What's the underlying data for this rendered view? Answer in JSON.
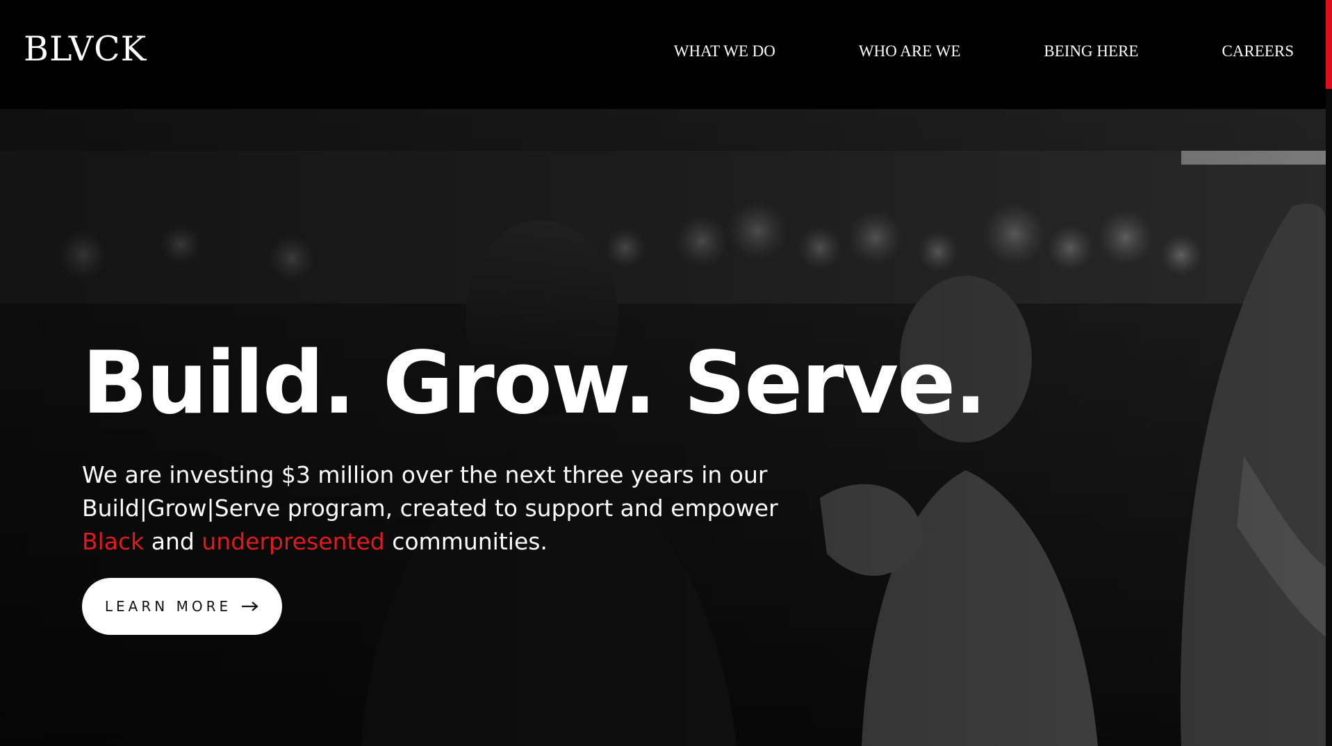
{
  "header": {
    "logo": "BLVCK",
    "nav": [
      {
        "label": "WHAT WE DO"
      },
      {
        "label": "WHO ARE WE"
      },
      {
        "label": "BEING HERE"
      },
      {
        "label": "CAREERS"
      }
    ]
  },
  "hero": {
    "title": "Build. Grow. Serve.",
    "desc_part1": "We are investing $3 million over the next three years in our Build|Grow|Serve program, created to support and empower ",
    "desc_highlight1": "Black",
    "desc_part2": " and ",
    "desc_highlight2": "underpresented",
    "desc_part3": " communities.",
    "cta_label": "LEARN MORE"
  },
  "colors": {
    "accent": "#e01b1b",
    "background": "#000000",
    "button_bg": "#ffffff"
  }
}
